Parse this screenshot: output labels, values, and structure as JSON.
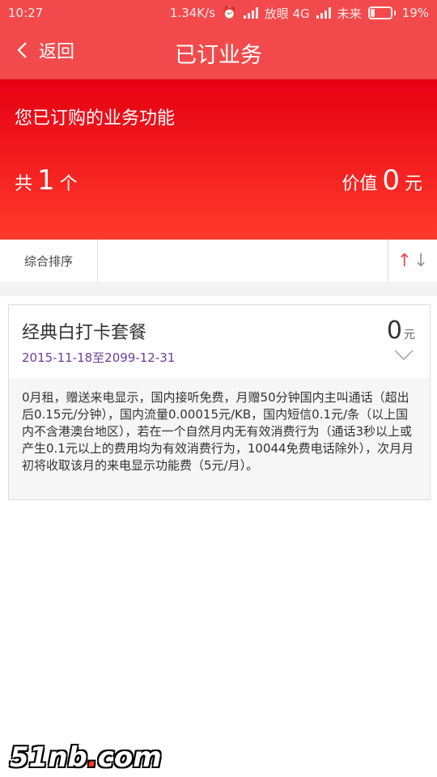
{
  "status_bar": {
    "time": "10:27",
    "speed": "1.34K/s",
    "carrier1": "放眼 4G",
    "carrier2": "未来",
    "battery": "19%"
  },
  "nav": {
    "back_label": "返回",
    "title": "已订业务"
  },
  "summary": {
    "heading": "您已订购的业务功能",
    "count_prefix": "共",
    "count": "1",
    "count_suffix": "个",
    "value_prefix": "价值",
    "value": "0",
    "value_suffix": "元"
  },
  "sort": {
    "tab_label": "综合排序",
    "up_icon": "↑",
    "down_icon": "↓"
  },
  "services": [
    {
      "name": "经典白打卡套餐",
      "date_range": "2015-11-18至2099-12-31",
      "price": "0",
      "unit": "元",
      "description": "0月租，赠送来电显示，国内接听免费，月赠50分钟国内主叫通话（超出后0.15元/分钟），国内流量0.00015元/KB，国内短信0.1元/条（以上国内不含港澳台地区），若在一个自然月内无有效消费行为（通话3秒以上或产生0.1元以上的费用均为有效消费行为，10044免费电话除外），次月月初将收取该月的来电显示功能费（5元/月）。"
    }
  ],
  "watermark": {
    "text_a": "51nb",
    "dot": ".",
    "text_b": "com"
  },
  "colors": {
    "brand_red": "#f24a4c",
    "hero_top": "#e60012",
    "date_purple": "#6b3f9a"
  }
}
